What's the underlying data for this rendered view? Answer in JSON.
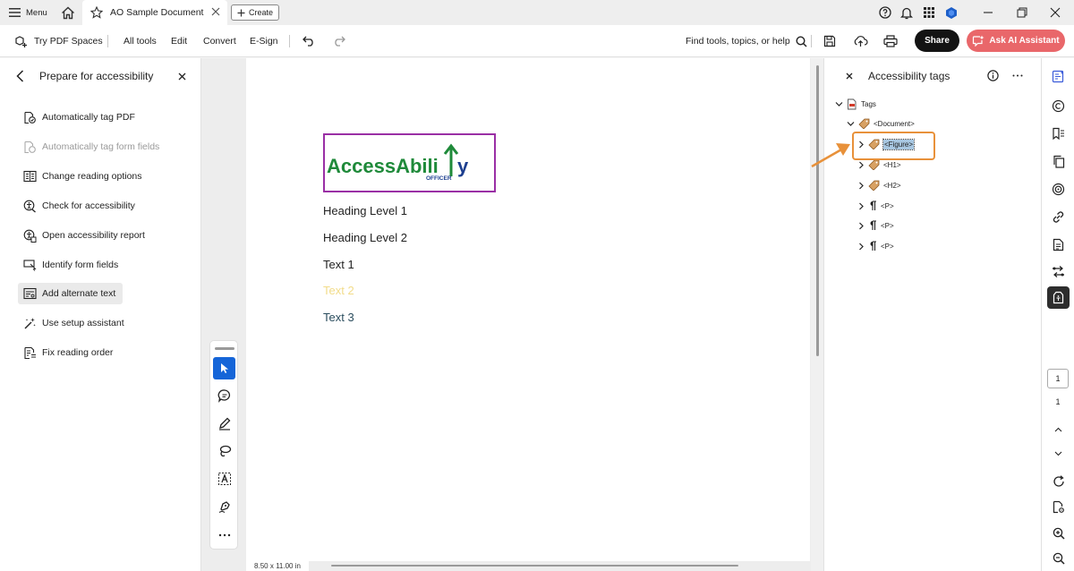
{
  "titlebar": {
    "menu_label": "Menu",
    "doc_tab_title": "AO Sample Document",
    "create_label": "Create"
  },
  "toolbar": {
    "spaces_label": "Try PDF Spaces",
    "all_tools": "All tools",
    "edit": "Edit",
    "convert": "Convert",
    "esign": "E-Sign",
    "find_placeholder": "Find tools, topics, or help",
    "share_label": "Share",
    "ai_label": "Ask AI Assistant"
  },
  "left_panel": {
    "title": "Prepare for accessibility",
    "items": [
      {
        "label": "Automatically tag PDF",
        "icon": "tag-pdf-icon",
        "disabled": false,
        "selected": false
      },
      {
        "label": "Automatically tag form fields",
        "icon": "tag-form-icon",
        "disabled": true,
        "selected": false
      },
      {
        "label": "Change reading options",
        "icon": "reading-options-icon",
        "disabled": false,
        "selected": false
      },
      {
        "label": "Check for accessibility",
        "icon": "accessibility-check-icon",
        "disabled": false,
        "selected": false
      },
      {
        "label": "Open accessibility report",
        "icon": "report-icon",
        "disabled": false,
        "selected": false
      },
      {
        "label": "Identify form fields",
        "icon": "form-fields-icon",
        "disabled": false,
        "selected": false
      },
      {
        "label": "Add alternate text",
        "icon": "alt-text-icon",
        "disabled": false,
        "selected": true
      },
      {
        "label": "Use setup assistant",
        "icon": "setup-assistant-icon",
        "disabled": false,
        "selected": false
      },
      {
        "label": "Fix reading order",
        "icon": "reading-order-icon",
        "disabled": false,
        "selected": false
      }
    ]
  },
  "document": {
    "logo_main": "AccessAbili",
    "logo_tail": "y",
    "logo_sub": "OFFICER",
    "heading1": "Heading Level 1",
    "heading2": "Heading Level 2",
    "text1": "Text 1",
    "text2": "Text 2",
    "text3": "Text 3",
    "page_size": "8.50 x 11.00 in",
    "colors": {
      "text2": "#f2dc8a",
      "text3": "#2b4d5e",
      "logo_green": "#1f8a3a",
      "logo_blue": "#1d3f8f",
      "logo_border": "#9a2fa5"
    }
  },
  "right_panel": {
    "title": "Accessibility tags",
    "tree": {
      "root": "Tags",
      "document": "<Document>",
      "children": [
        "<Figure>",
        "<H1>",
        "<H2>",
        "<P>",
        "<P>",
        "<P>"
      ]
    },
    "highlight_color": "#e8913a"
  },
  "rail": {
    "page_current": "1",
    "page_total": "1"
  }
}
